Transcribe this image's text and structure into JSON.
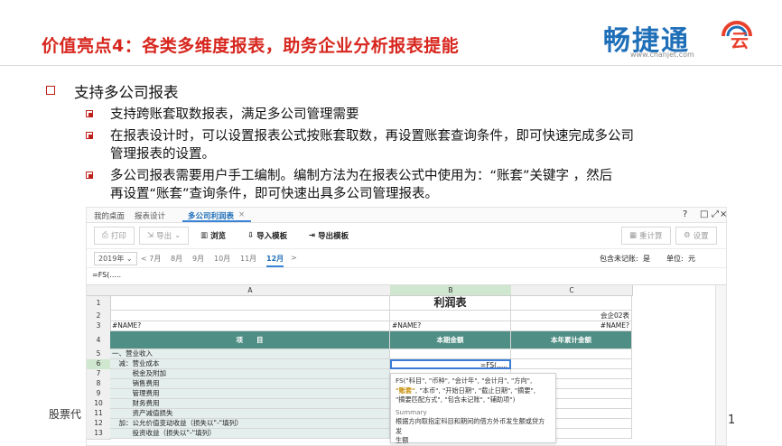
{
  "slide": {
    "title": "价值亮点4：各类多维度报表，助务企业分析报表提能",
    "logo_text_a": "畅捷通",
    "logo_url": "www.chanjet.com",
    "heading": "支持多公司报表",
    "bullets": [
      "支持跨账套取数报表，满足多公司管理需要",
      "在报表设计时，可以设置报表公式按账套取数，再设置账套查询条件，即可快速完成多公司",
      "管理报表的设置。",
      "多公司报表需要用户手工编制。编制方法为在报表公式中使用为：“账套”关键字 ，然后",
      "再设置“账套”查询条件，即可快速出具多公司管理报表。"
    ],
    "footer": "股票代",
    "page_number": "1"
  },
  "app": {
    "tabs": [
      "我的桌面",
      "报表设计",
      "多公司利润表"
    ],
    "tab_close": "×",
    "window_controls": [
      "?",
      "□",
      "⤢",
      "×"
    ],
    "toolbar": {
      "print": "打印",
      "export": "导出",
      "export_caret": "⌄",
      "preview": "浏览",
      "import_template": "导入模板",
      "export_template": "导出模板",
      "recalc": "重计算",
      "settings": "设置"
    },
    "period": {
      "year": "2019年",
      "year_caret": "⌄",
      "months": [
        "< 7月",
        "8月",
        "9月",
        "10月",
        "11月",
        "12月"
      ],
      "selected_index": 5,
      "right_arrow": ">",
      "unposted_label": "包含未记账:",
      "unposted_value": "是",
      "unit_label": "单位:",
      "unit_value": "元"
    },
    "formula": "=FS(.....",
    "columns": [
      "A",
      "B",
      "C"
    ],
    "rows": [
      {
        "n": "1",
        "a": "",
        "b": "利润表",
        "c": ""
      },
      {
        "n": "2",
        "a": "",
        "b": "",
        "c": "会企02表"
      },
      {
        "n": "3",
        "a": "#NAME?",
        "b": "#NAME?",
        "c": "#NAME?"
      },
      {
        "n": "4",
        "a": "项　　目",
        "b": "本期金额",
        "c": "本年累计金额"
      },
      {
        "n": "5",
        "a": "一、营业收入",
        "b": "",
        "c": ""
      },
      {
        "n": "6",
        "a": "　减：营业成本",
        "b": "=FS(.....",
        "c": ""
      },
      {
        "n": "7",
        "a": "　　　税金及附加",
        "b": "",
        "c": ""
      },
      {
        "n": "8",
        "a": "　　　销售费用",
        "b": "",
        "c": ""
      },
      {
        "n": "9",
        "a": "　　　管理费用",
        "b": "",
        "c": ""
      },
      {
        "n": "10",
        "a": "　　　财务费用",
        "b": "",
        "c": ""
      },
      {
        "n": "11",
        "a": "　　　资产减值损失",
        "b": "",
        "c": ""
      },
      {
        "n": "12",
        "a": "　加：公允价值变动收益（损失以\"-\"填列）",
        "b": "",
        "c": ""
      },
      {
        "n": "13",
        "a": "　　　投资收益（损失以\"-\"填列）",
        "b": "",
        "c": ""
      }
    ],
    "hint": {
      "line1": "FS(\"科目\", \"币种\", \"会计年\", \"会计月\", \"方向\",",
      "line2_hl": "\"账套\"",
      "line2_rest": ", \"本币\", \"开始日期\", \"截止日期\", \"摘要\",",
      "line3": "\"摘要匹配方式\", \"包含未记账\", \"辅助项\")",
      "summary_label": "Summary",
      "summary_1": "根据方向取指定科目和期间的借方外币发生额或贷方发",
      "summary_2": "生额"
    }
  },
  "colors": {
    "title_red": "#d7261e",
    "brand_blue": "#1f6fb8",
    "teal": "#4f8e84",
    "selected_blue": "#3a85d8"
  }
}
